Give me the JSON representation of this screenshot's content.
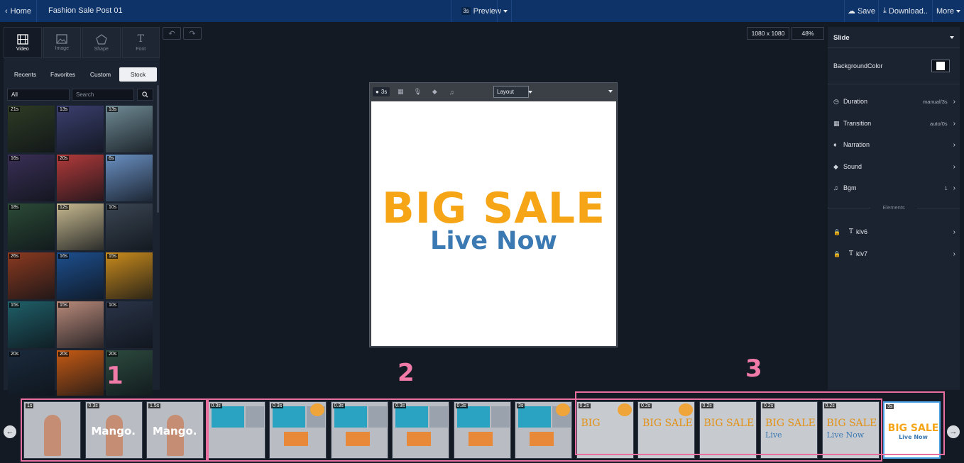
{
  "topbar": {
    "home_label": "Home",
    "project_title": "Fashion Sale Post 01",
    "preview_badge": "3s",
    "preview_label": "Preview",
    "save_label": "Save",
    "download_label": "Download..",
    "more_label": "More"
  },
  "left_panel": {
    "categories": [
      {
        "label": "Video",
        "icon": "film-icon"
      },
      {
        "label": "Image",
        "icon": "image-icon"
      },
      {
        "label": "Shape",
        "icon": "pentagon-icon"
      },
      {
        "label": "Font",
        "icon": "text-icon"
      }
    ],
    "tabs": [
      "Recents",
      "Favorites",
      "Custom",
      "Stock"
    ],
    "active_tab": "Stock",
    "filter_value": "All",
    "search_placeholder": "Search",
    "thumbnails": [
      {
        "duration": "21s",
        "color": "#2e3b24"
      },
      {
        "duration": "13s",
        "color": "#3b3f6e"
      },
      {
        "duration": "13s",
        "color": "#6f8a94"
      },
      {
        "duration": "16s",
        "color": "#3a2f55"
      },
      {
        "duration": "20s",
        "color": "#b23a3a"
      },
      {
        "duration": "6s",
        "color": "#6a90c2"
      },
      {
        "duration": "18s",
        "color": "#2b4a36"
      },
      {
        "duration": "12s",
        "color": "#c7b98f"
      },
      {
        "duration": "10s",
        "color": "#3a4552"
      },
      {
        "duration": "26s",
        "color": "#8b3a1f"
      },
      {
        "duration": "16s",
        "color": "#1d4f8e"
      },
      {
        "duration": "15s",
        "color": "#c98b1c"
      },
      {
        "duration": "15s",
        "color": "#1f5f68"
      },
      {
        "duration": "15s",
        "color": "#b98a7a"
      },
      {
        "duration": "10s",
        "color": "#2a3448"
      },
      {
        "duration": "20s",
        "color": "#1a2a3c"
      },
      {
        "duration": "20s",
        "color": "#c55a14"
      },
      {
        "duration": "20s",
        "color": "#2c4a3e"
      }
    ]
  },
  "editor": {
    "canvas_size": "1080 x 1080",
    "zoom": "48%",
    "slide_duration": "3s",
    "layout_label": "Layout",
    "slide_title": "BIG SALE",
    "slide_subtitle": "Live Now"
  },
  "right_panel": {
    "header": "Slide",
    "bg_color_label": "BackgroundColor",
    "bg_color": "#ffffff",
    "rows": [
      {
        "label": "Duration",
        "value": "manual/3s",
        "icon": "clock-icon"
      },
      {
        "label": "Transition",
        "value": "auto/0s",
        "icon": "grid-icon"
      },
      {
        "label": "Narration",
        "value": "",
        "icon": "mic-icon"
      },
      {
        "label": "Sound",
        "value": "",
        "icon": "sound-icon"
      },
      {
        "label": "Bgm",
        "value": "1",
        "icon": "music-icon"
      }
    ],
    "elements_label": "Elements",
    "elements": [
      {
        "label": "klv6",
        "icon": "lock-icon"
      },
      {
        "label": "klv7",
        "icon": "lock-icon"
      }
    ]
  },
  "timeline": {
    "frames": [
      {
        "duration": "1s",
        "kind": "person"
      },
      {
        "duration": "0.3s",
        "kind": "mango",
        "text": "Mango."
      },
      {
        "duration": "1.5s",
        "kind": "mango",
        "text": "Mango."
      },
      {
        "duration": "0.3s",
        "kind": "blue"
      },
      {
        "duration": "0.3s",
        "kind": "blue"
      },
      {
        "duration": "0.3s",
        "kind": "blue"
      },
      {
        "duration": "0.3s",
        "kind": "blue"
      },
      {
        "duration": "0.3s",
        "kind": "blue"
      },
      {
        "duration": "3s",
        "kind": "blue"
      },
      {
        "duration": "0.2s",
        "kind": "big",
        "text": "BIG"
      },
      {
        "duration": "0.2s",
        "kind": "big",
        "text": "BIG SALE"
      },
      {
        "duration": "0.2s",
        "kind": "big",
        "text": "BIG SALE"
      },
      {
        "duration": "0.2s",
        "kind": "big",
        "text": "BIG SALE",
        "sub": "Live"
      },
      {
        "duration": "0.2s",
        "kind": "big",
        "text": "BIG SALE",
        "sub": "Live Now"
      },
      {
        "duration": "3s",
        "kind": "final",
        "text": "BIG SALE",
        "sub": "Live Now"
      }
    ],
    "callouts": [
      "1",
      "2",
      "3"
    ]
  }
}
